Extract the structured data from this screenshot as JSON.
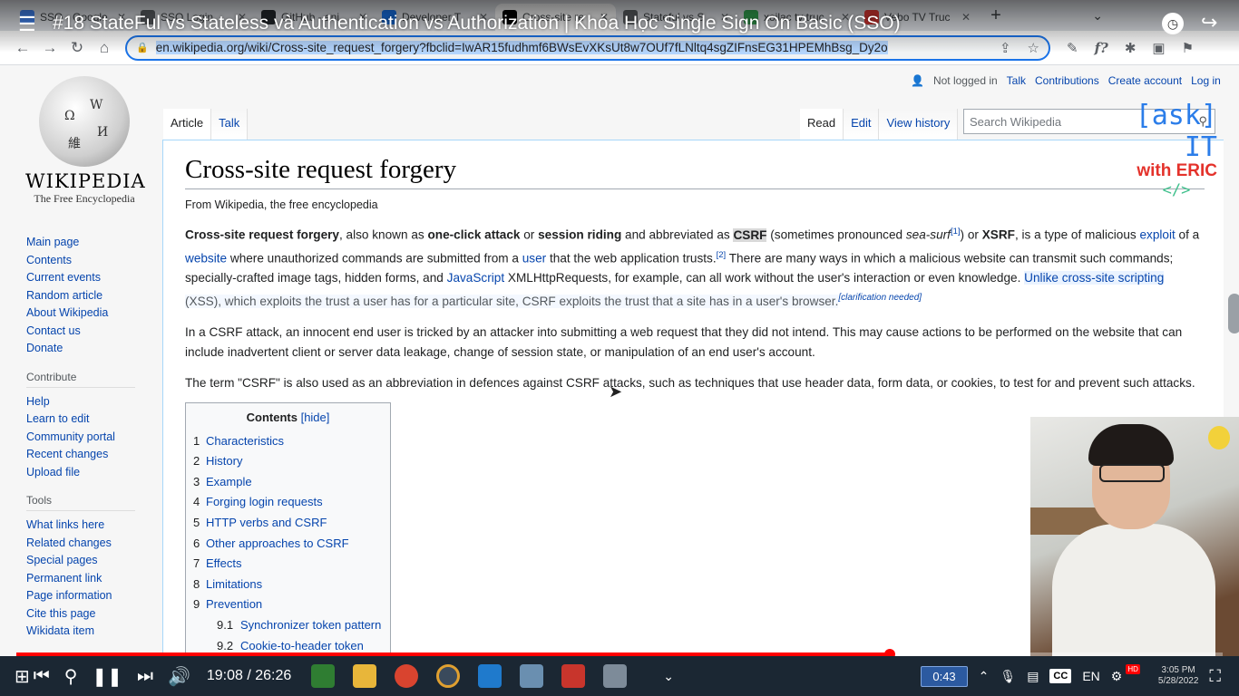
{
  "browser": {
    "tabs": [
      {
        "label": "SSO - Google",
        "color": "#4285f4"
      },
      {
        "label": "SSO Login",
        "color": "#5f6368"
      },
      {
        "label": "GitHub - ani",
        "color": "#24292e"
      },
      {
        "label": "Developer T",
        "color": "#1877f2"
      },
      {
        "label": "Cross-site re",
        "color": "#000000",
        "active": true
      },
      {
        "label": "Stateful vs S",
        "color": "#5f6368"
      },
      {
        "label": "xoilac tv truc",
        "color": "#34a853"
      },
      {
        "label": "Vebo TV Truc",
        "color": "#e53935"
      }
    ],
    "url": "en.wikipedia.org/wiki/Cross-site_request_forgery?fbclid=IwAR15fudhmf6BWsEvXKsUt8w7OUf7fLNltq4sgZIFnsEG31HPEMhBsg_Dy2o"
  },
  "video": {
    "title": "#18 StateFul vs Stateless và Authentication vs Authorization | Khóa Học Single Sign On Basic (SSO)",
    "current_time": "19:08",
    "duration": "26:26",
    "time_display": "19:08 / 26:26",
    "progress": 0.7238,
    "chip_time": "0:43",
    "brand": {
      "line1": "[ask] IT",
      "line2": "with ERIC",
      "line3": "</>"
    }
  },
  "wiki": {
    "logo_word": "WIKIPEDIA",
    "tagline": "The Free Encyclopedia",
    "personal": {
      "not_logged": "Not logged in",
      "talk": "Talk",
      "contributions": "Contributions",
      "create": "Create account",
      "login": "Log in"
    },
    "tabs_left": [
      "Article",
      "Talk"
    ],
    "tabs_right": [
      "Read",
      "Edit",
      "View history"
    ],
    "search_placeholder": "Search Wikipedia",
    "nav_main": [
      "Main page",
      "Contents",
      "Current events",
      "Random article",
      "About Wikipedia",
      "Contact us",
      "Donate"
    ],
    "contribute_heading": "Contribute",
    "nav_contribute": [
      "Help",
      "Learn to edit",
      "Community portal",
      "Recent changes",
      "Upload file"
    ],
    "tools_heading": "Tools",
    "nav_tools": [
      "What links here",
      "Related changes",
      "Special pages",
      "Permanent link",
      "Page information",
      "Cite this page",
      "Wikidata item"
    ],
    "title": "Cross-site request forgery",
    "from": "From Wikipedia, the free encyclopedia",
    "p2": "In a CSRF attack, an innocent end user is tricked by an attacker into submitting a web request that they did not intend. This may cause actions to be performed on the website that can include inadvertent client or server data leakage, change of session state, or manipulation of an end user's account.",
    "p3": "The term \"CSRF\" is also used as an abbreviation in defences against CSRF attacks, such as techniques that use header data, form data, or cookies, to test for and prevent such attacks.",
    "toc_title": "Contents",
    "toc_hide": "[hide]",
    "toc": [
      {
        "num": "1",
        "label": "Characteristics"
      },
      {
        "num": "2",
        "label": "History"
      },
      {
        "num": "3",
        "label": "Example"
      },
      {
        "num": "4",
        "label": "Forging login requests"
      },
      {
        "num": "5",
        "label": "HTTP verbs and CSRF"
      },
      {
        "num": "6",
        "label": "Other approaches to CSRF"
      },
      {
        "num": "7",
        "label": "Effects"
      },
      {
        "num": "8",
        "label": "Limitations"
      },
      {
        "num": "9",
        "label": "Prevention"
      },
      {
        "num": "9.1",
        "label": "Synchronizer token pattern",
        "sub": true
      },
      {
        "num": "9.2",
        "label": "Cookie-to-header token",
        "sub": true
      }
    ],
    "p1": {
      "b1": "Cross-site request forgery",
      "t1": ", also known as ",
      "b2": "one-click attack",
      "t2": " or ",
      "b3": "session riding",
      "t3": " and abbreviated as ",
      "b4": "CSRF",
      "t4": " (sometimes pronounced ",
      "i1": "sea-surf",
      "s1": "[1]",
      "t5": ") or ",
      "b5": "XSRF",
      "t6": ", is a type of malicious ",
      "l1": "exploit",
      "t7": " of a ",
      "l2": "website",
      "t8": " where unauthorized commands are submitted from a ",
      "l3": "user",
      "t9": " that the web application trusts.",
      "s2": "[2]",
      "t10": " There are many ways in which a malicious website can transmit such commands; specially-crafted image tags, hidden forms, and ",
      "l4": "JavaScript",
      "t11": " XMLHttpRequests, for example, can all work without the user's interaction or even knowledge. ",
      "l5": "Unlike cross-site scripting",
      "t12": " (XSS), which exploits the trust a user has for a particular site, CSRF exploits the trust that a site has in a user's browser.",
      "cn": "[clarification needed]"
    }
  },
  "taskbar": {
    "lang": "EN",
    "time": "3:05 PM",
    "date": "5/28/2022",
    "hd": "HD",
    "cc": "CC"
  }
}
